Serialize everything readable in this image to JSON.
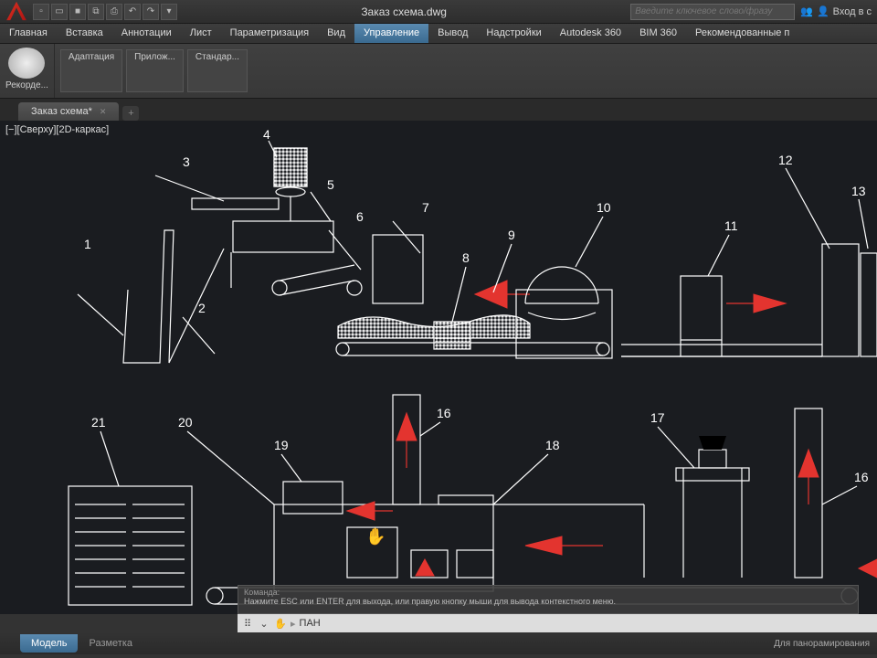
{
  "title": "Заказ схема.dwg",
  "search_placeholder": "Введите ключевое слово/фразу",
  "signin": "Вход в с",
  "menu": [
    "Главная",
    "Вставка",
    "Аннотации",
    "Лист",
    "Параметризация",
    "Вид",
    "Управление",
    "Вывод",
    "Надстройки",
    "Autodesk 360",
    "BIM 360",
    "Рекомендованные п"
  ],
  "active_menu": 6,
  "ribbon": {
    "rec": "Рекорде...",
    "items": [
      "Адаптация",
      "Прилож...",
      "Стандар..."
    ]
  },
  "filetab": "Заказ схема*",
  "viewtag": "[−][Сверху][2D-каркас]",
  "cmd": {
    "label": "Команда:",
    "hint": "Нажмите ESC или ENTER для выхода, или правую кнопку мыши для вывода контекстного меню.",
    "current": "ПАН"
  },
  "tabs": {
    "model": "Модель",
    "layout": "Разметка"
  },
  "status": "Для панорамирования",
  "labels": {
    "1": "1",
    "2": "2",
    "3": "3",
    "4": "4",
    "5": "5",
    "6": "6",
    "7": "7",
    "8": "8",
    "9": "9",
    "10": "10",
    "11": "11",
    "12": "12",
    "13": "13",
    "16": "16",
    "16b": "16",
    "17": "17",
    "18": "18",
    "19": "19",
    "20": "20",
    "21": "21"
  }
}
